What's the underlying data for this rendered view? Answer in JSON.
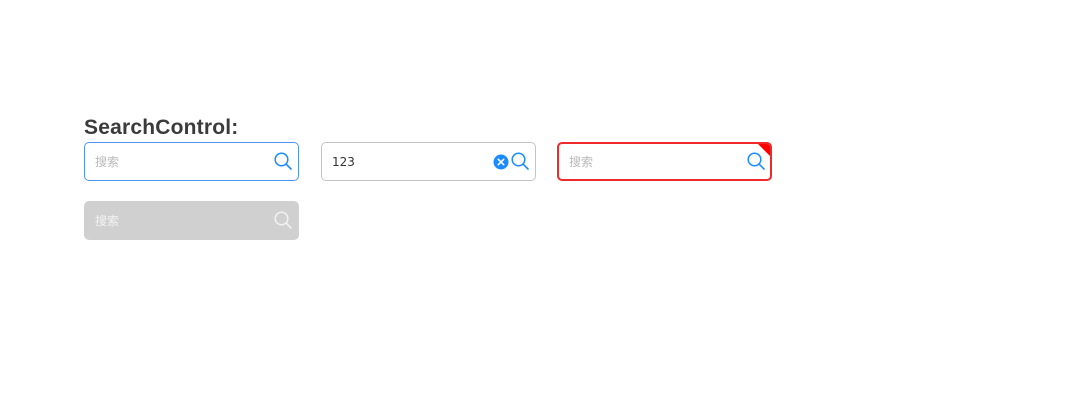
{
  "section": {
    "title": "SearchControl:"
  },
  "searches": [
    {
      "id": "focused",
      "value": "",
      "placeholder": "搜索",
      "state": "focused",
      "border_color": "#4f94f7"
    },
    {
      "id": "filled",
      "value": "123",
      "placeholder": "搜索",
      "state": "with-value",
      "border_color": "#c4c4c4"
    },
    {
      "id": "error",
      "value": "",
      "placeholder": "搜索",
      "state": "error",
      "border_color": "#ef2a2a"
    },
    {
      "id": "disabled",
      "value": "",
      "placeholder": "搜索",
      "state": "disabled",
      "background": "#d0d0d0"
    }
  ],
  "icons": {
    "search": "search-icon",
    "clear": "clear-circle-icon",
    "error_corner": "error-corner-marker"
  },
  "colors": {
    "accent": "#1a8cff",
    "error": "#ef2a2a",
    "disabled": "#d0d0d0"
  }
}
